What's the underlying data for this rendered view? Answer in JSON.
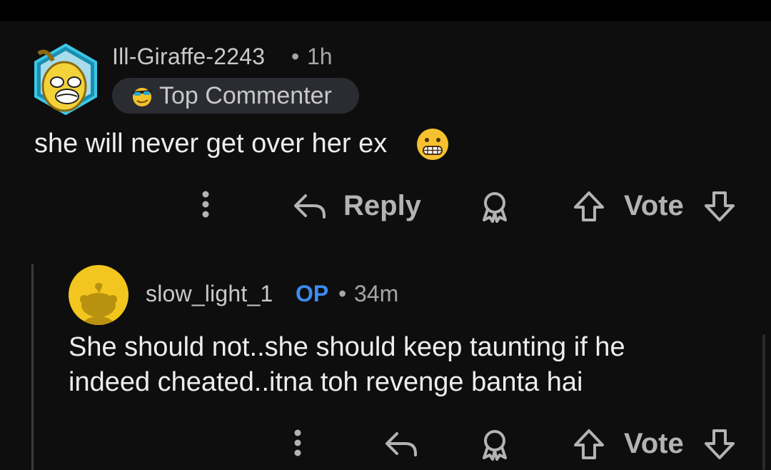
{
  "comments": [
    {
      "username": "Ill-Giraffe-2243",
      "separator": "•",
      "time": "1h",
      "flair": "Top Commenter",
      "text": "she will never get over her ex",
      "actions": {
        "reply": "Reply",
        "vote": "Vote"
      },
      "avatar_icon": "banana-avatar-icon",
      "flair_icon": "sunglasses-flair-icon",
      "emoji_icon": "grimacing-face-icon"
    },
    {
      "username": "slow_light_1",
      "op_badge": "OP",
      "separator": "•",
      "time": "34m",
      "text_line1": "She should not..she should keep taunting if he",
      "text_line2": "indeed cheated..itna toh revenge banta hai",
      "actions": {
        "vote": "Vote"
      },
      "avatar_icon": "snoo-avatar-icon"
    }
  ],
  "colors": {
    "background": "#0e0e0f",
    "text": "#ededed",
    "muted": "#a6a6a8",
    "op_blue": "#3d8cf0",
    "flair_bg": "#2a2c31",
    "avatar_yellow": "#f2c61f"
  }
}
